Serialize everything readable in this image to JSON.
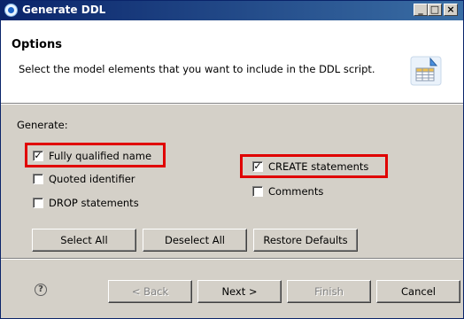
{
  "window": {
    "title": "Generate DDL"
  },
  "titlebar_buttons": {
    "minimize": "_",
    "maximize": "□",
    "close": "×"
  },
  "header": {
    "title": "Options",
    "description": "Select the model elements that you want to include in the DDL script.",
    "icon": "ddl-table-icon"
  },
  "generate": {
    "label": "Generate:",
    "options": [
      {
        "label": "Fully qualified name",
        "checked": true,
        "highlighted": true
      },
      {
        "label": "Quoted identifier",
        "checked": false,
        "highlighted": false
      },
      {
        "label": "DROP statements",
        "checked": false,
        "highlighted": false
      },
      {
        "label": "CREATE statements",
        "checked": true,
        "highlighted": true
      },
      {
        "label": "Comments",
        "checked": false,
        "highlighted": false
      }
    ]
  },
  "selection_buttons": {
    "select_all": "Select All",
    "deselect_all": "Deselect All",
    "restore_defaults": "Restore Defaults"
  },
  "footer": {
    "help": "?",
    "back": "< Back",
    "next": "Next >",
    "finish": "Finish",
    "cancel": "Cancel"
  },
  "colors": {
    "highlight": "#e00000",
    "titlebar": "#0a246a",
    "dialog": "#d4d0c8"
  }
}
